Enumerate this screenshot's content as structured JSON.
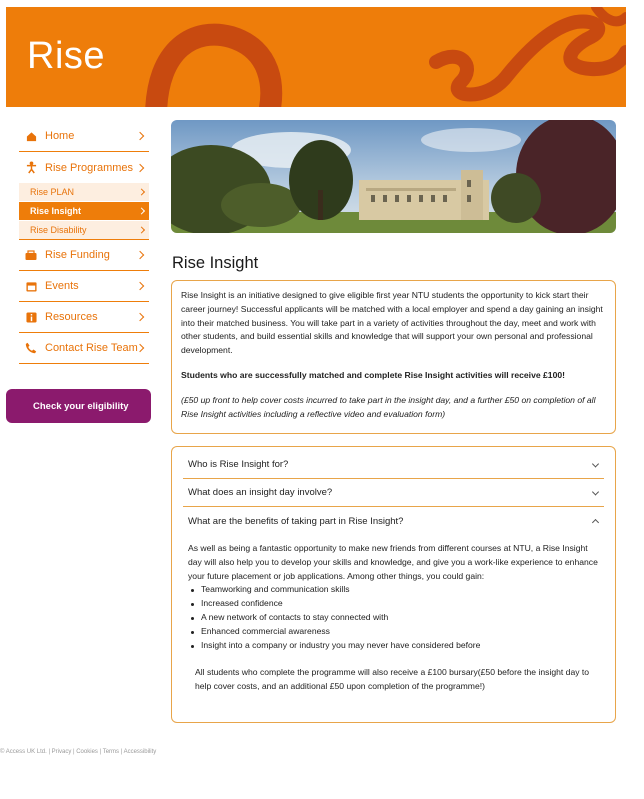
{
  "header": {
    "brand": "Rise"
  },
  "colors": {
    "brand_orange": "#ee7d0a",
    "swirl_dark": "#c84a10",
    "eligibility_purple": "#8b1a6d",
    "border_orange": "#e8a54a"
  },
  "sidebar": {
    "items": [
      {
        "label": "Home",
        "icon": "home-icon"
      },
      {
        "label": "Rise Programmes",
        "icon": "person-icon"
      },
      {
        "label": "Rise Funding",
        "icon": "funding-icon"
      },
      {
        "label": "Events",
        "icon": "calendar-icon"
      },
      {
        "label": "Resources",
        "icon": "info-icon"
      },
      {
        "label": "Contact Rise Team",
        "icon": "phone-icon"
      }
    ],
    "sub_items": [
      {
        "label": "Rise PLAN",
        "active": false
      },
      {
        "label": "Rise Insight",
        "active": true
      },
      {
        "label": "Rise Disability",
        "active": false
      }
    ]
  },
  "eligibility_button": "Check your eligibility",
  "main": {
    "title": "Rise Insight",
    "intro": "Rise Insight is an initiative designed to give eligible first year NTU students the opportunity to kick start their career journey! Successful applicants will be matched with a local employer and spend a day gaining an insight into their matched business. You will take part in a variety of activities throughout the day, meet and work with other students, and build essential skills and knowledge that will support your own personal and professional development.",
    "reward": "Students who are successfully matched and complete Rise Insight activities will receive £100!",
    "reward_note": "(£50 up front to help cover costs incurred to take part in the insight day, and a further £50 on completion of all Rise Insight activities including a reflective video and evaluation form)"
  },
  "accordion": {
    "q1": "Who is Rise Insight for?",
    "q2": "What does an insight day involve?",
    "q3": "What are the benefits of taking part in Rise Insight?",
    "a3_intro": "As well as being a fantastic opportunity to make new friends from different courses at NTU, a Rise Insight day will also help you to develop your skills and knowledge, and give you a work-like experience to enhance your future placement or job applications. Among other things, you could gain:",
    "a3_bullets": [
      "Teamworking and communication skills",
      "Increased confidence",
      "A new network of contacts to stay connected with",
      "Enhanced commercial awareness",
      "Insight into a company or industry you may never have considered before"
    ],
    "a3_note": "All students who complete the programme will also receive a £100 bursary(£50 before the insight day to help cover costs, and an additional £50 upon completion of the programme!)"
  },
  "footer": "© Access UK Ltd. | Privacy | Cookies | Terms | Accessibility"
}
